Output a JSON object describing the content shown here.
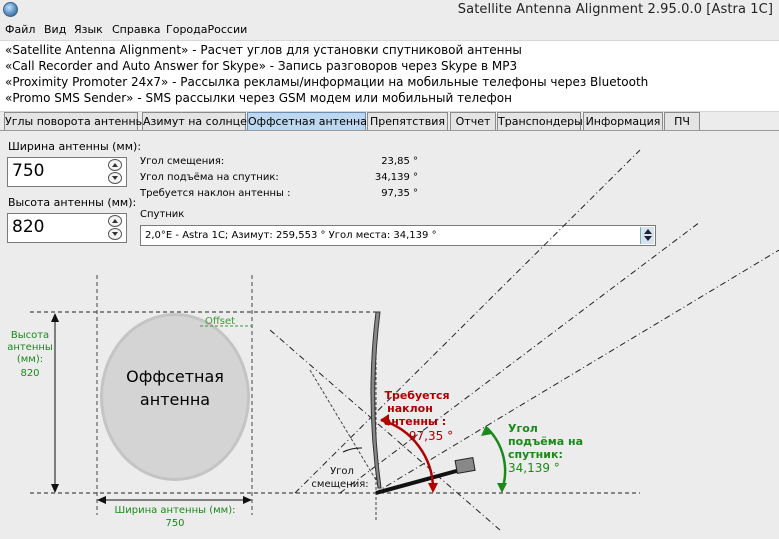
{
  "window": {
    "title": "Satellite Antenna Alignment 2.95.0.0 [Astra 1C]",
    "icon": "satellite-icon"
  },
  "menu": [
    "Файл",
    "Вид",
    "Язык",
    "Справка",
    "ГородаРоссии"
  ],
  "ads": [
    "«Satellite Antenna Alignment» - Расчет углов для установки спутниковой антенны",
    "«Call Recorder and Auto Answer for Skype» - Запись разговоров через Skype в MP3",
    "«Proximity Promoter 24x7» - Рассылка рекламы/информации на мобильные телефоны через Bluetooth",
    "«Promo SMS Sender» - SMS рассылки через GSM модем или мобильный телефон"
  ],
  "tabs": [
    "Углы поворота антенны",
    "Азимут на солнце",
    "Оффсетная антенна",
    "Препятствия",
    "Отчет",
    "Транспондеры",
    "Информация",
    "ПЧ"
  ],
  "active_tab": "Оффсетная антенна",
  "inputs": {
    "width": {
      "label": "Ширина антенны (мм):",
      "value": "750"
    },
    "height": {
      "label": "Высота антенны (мм):",
      "value": "820"
    }
  },
  "info": {
    "offset_angle": {
      "label": "Угол смещения:",
      "value": "23,85 °"
    },
    "elevation": {
      "label": "Угол подъёма на спутник:",
      "value": "34,139 °"
    },
    "tilt": {
      "label": "Требуется наклон антенны :",
      "value": "97,35 °"
    }
  },
  "satellite": {
    "label": "Спутник",
    "selected": "2,0°E - Astra 1C;  Азимут: 259,553 °  Угол места: 34,139 °"
  },
  "diagram": {
    "height_label_1": "Высота",
    "height_label_2": "антенны",
    "height_label_3": "(мм):",
    "height_value": "820",
    "dish_title_1": "Оффсетная",
    "dish_title_2": "антенна",
    "offset_label": "Offset",
    "width_label": "Ширина антенны (мм):",
    "width_value": "750",
    "tilt_label_1": "Требуется",
    "tilt_label_2": "наклон",
    "tilt_label_3": "антенны :",
    "tilt_value": "97,35 °",
    "offset_angle_label_1": "Угол",
    "offset_angle_label_2": "смещения:",
    "elev_label_1": "Угол",
    "elev_label_2": "подъёма на",
    "elev_label_3": "спутник:",
    "elev_value": "34,139 °"
  },
  "colors": {
    "tilt": "#b00000",
    "elevation": "#1a8a1a",
    "offset": "#3a9a3a",
    "active_tab": "#bcd7ee"
  }
}
